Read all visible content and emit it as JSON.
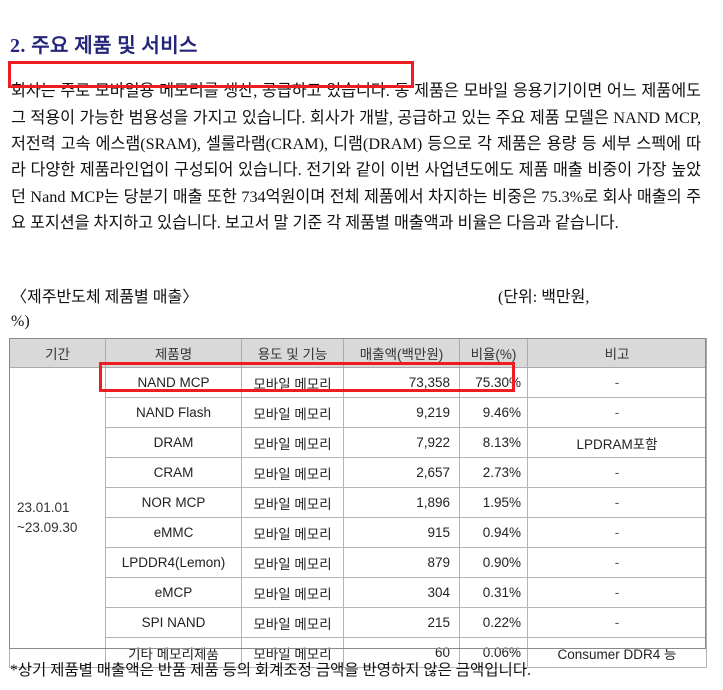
{
  "document": {
    "section_number_title": "2. 주요 제품 및 서비스",
    "title_color": "#25257a",
    "highlight_color": "#ee1d22",
    "header_bg": "#d9d9d9"
  },
  "paragraph": {
    "highlighted_sentence": "회사는 주로 모바일용 메모리를 생산, 공급하고 있습니다.",
    "rest": " 동 제품은 모바일 응용기기이면 어느 제품에도 그 적용이 가능한 범용성을 가지고 있습니다. 회사가 개발, 공급하고 있는 주요 제품 모델은 NAND MCP, 저전력 고속 에스램(SRAM), 셀룰라램(CRAM), 디램(DRAM) 등으로 각 제품은 용량 등 세부 스펙에 따라 다양한 제품라인업이 구성되어 있습니다. 전기와 같이 이번 사업년도에도 제품 매출 비중이 가장 높았던 Nand MCP는 당분기 매출 또한 734억원이며 전체 제품에서 차지하는 비중은 75.3%로 회사 매출의 주요 포지션을 차지하고 있습니다. 보고서 말 기준 각 제품별 매출액과 비율은 다음과 같습니다."
  },
  "caption": {
    "title": "〈제주반도체 제품별 매출〉",
    "unit_line1": "(단위: 백만원,",
    "unit_line2": "%)"
  },
  "table": {
    "headers": [
      "기간",
      "제품명",
      "용도 및 기능",
      "매출액(백만원)",
      "비율(%)",
      "비고"
    ],
    "period": {
      "line1": "23.01.01",
      "line2": "~23.09.30"
    },
    "rows": [
      {
        "product": "NAND MCP",
        "use": "모바일 메모리",
        "amount": "73,358",
        "ratio": "75.30%",
        "remark": "-"
      },
      {
        "product": "NAND Flash",
        "use": "모바일 메모리",
        "amount": "9,219",
        "ratio": "9.46%",
        "remark": "-"
      },
      {
        "product": "DRAM",
        "use": "모바일 메모리",
        "amount": "7,922",
        "ratio": "8.13%",
        "remark": "LPDRAM포함"
      },
      {
        "product": "CRAM",
        "use": "모바일 메모리",
        "amount": "2,657",
        "ratio": "2.73%",
        "remark": "-"
      },
      {
        "product": "NOR MCP",
        "use": "모바일 메모리",
        "amount": "1,896",
        "ratio": "1.95%",
        "remark": "-"
      },
      {
        "product": "eMMC",
        "use": "모바일 메모리",
        "amount": "915",
        "ratio": "0.94%",
        "remark": "-"
      },
      {
        "product": "LPDDR4(Lemon)",
        "use": "모바일 메모리",
        "amount": "879",
        "ratio": "0.90%",
        "remark": "-"
      },
      {
        "product": "eMCP",
        "use": "모바일 메모리",
        "amount": "304",
        "ratio": "0.31%",
        "remark": "-"
      },
      {
        "product": "SPI NAND",
        "use": "모바일 메모리",
        "amount": "215",
        "ratio": "0.22%",
        "remark": "-"
      },
      {
        "product": "기타  메모리제품",
        "use": "모바일 메모리",
        "amount": "60",
        "ratio": "0.06%",
        "remark": "Consumer DDR4 등"
      }
    ]
  },
  "footnote": {
    "text": "*상기 제품별 매출액은 반품 제품 등의 회계조정 금액을 반영하지 않은 금액입니다."
  }
}
